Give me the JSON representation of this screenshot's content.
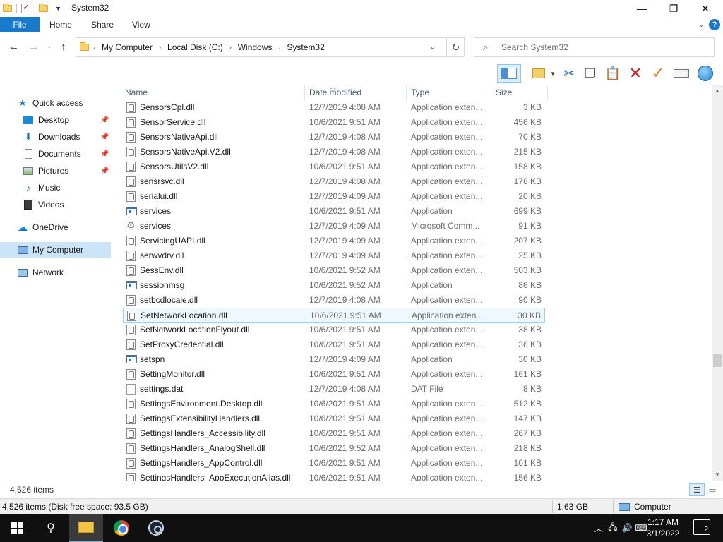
{
  "window": {
    "title": "System32",
    "minimize_glyph": "—",
    "maximize_glyph": "❐",
    "close_glyph": "✕"
  },
  "ribbon": {
    "tabs": [
      {
        "label": "File"
      },
      {
        "label": "Home"
      },
      {
        "label": "Share"
      },
      {
        "label": "View"
      }
    ],
    "help_label": "?"
  },
  "address": {
    "crumbs": [
      "My Computer",
      "Local Disk (C:)",
      "Windows",
      "System32"
    ]
  },
  "search": {
    "placeholder": "Search System32"
  },
  "toolbar": {
    "icons": [
      "layout-pane-icon",
      "new-folder-icon",
      "cut-icon",
      "copy-icon",
      "paste-icon",
      "delete-icon",
      "check-icon",
      "rename-icon",
      "globe-icon"
    ]
  },
  "sidebar": {
    "items": [
      {
        "label": "Quick access",
        "icon": "star-icon",
        "pinned": false
      },
      {
        "label": "Desktop",
        "icon": "desktop-icon",
        "pinned": true
      },
      {
        "label": "Downloads",
        "icon": "download-icon",
        "pinned": true
      },
      {
        "label": "Documents",
        "icon": "documents-icon",
        "pinned": true
      },
      {
        "label": "Pictures",
        "icon": "pictures-icon",
        "pinned": true
      },
      {
        "label": "Music",
        "icon": "music-icon",
        "pinned": false
      },
      {
        "label": "Videos",
        "icon": "videos-icon",
        "pinned": false
      },
      {
        "label": "OneDrive",
        "icon": "cloud-icon",
        "pinned": false
      },
      {
        "label": "My Computer",
        "icon": "computer-icon",
        "pinned": false,
        "selected": true
      },
      {
        "label": "Network",
        "icon": "network-icon",
        "pinned": false
      }
    ]
  },
  "columns": {
    "name": "Name",
    "date": "Date modified",
    "type": "Type",
    "size": "Size"
  },
  "files": [
    {
      "name": "SensorsCpl.dll",
      "date": "12/7/2019 4:08 AM",
      "type": "Application exten...",
      "size": "3 KB",
      "icon": "dll"
    },
    {
      "name": "SensorService.dll",
      "date": "10/6/2021 9:51 AM",
      "type": "Application exten...",
      "size": "456 KB",
      "icon": "dll"
    },
    {
      "name": "SensorsNativeApi.dll",
      "date": "12/7/2019 4:08 AM",
      "type": "Application exten...",
      "size": "70 KB",
      "icon": "dll"
    },
    {
      "name": "SensorsNativeApi.V2.dll",
      "date": "12/7/2019 4:08 AM",
      "type": "Application exten...",
      "size": "215 KB",
      "icon": "dll"
    },
    {
      "name": "SensorsUtilsV2.dll",
      "date": "10/6/2021 9:51 AM",
      "type": "Application exten...",
      "size": "158 KB",
      "icon": "dll"
    },
    {
      "name": "sensrsvc.dll",
      "date": "12/7/2019 4:08 AM",
      "type": "Application exten...",
      "size": "178 KB",
      "icon": "dll"
    },
    {
      "name": "serialui.dll",
      "date": "12/7/2019 4:09 AM",
      "type": "Application exten...",
      "size": "20 KB",
      "icon": "dll"
    },
    {
      "name": "services",
      "date": "10/6/2021 9:51 AM",
      "type": "Application",
      "size": "699 KB",
      "icon": "app"
    },
    {
      "name": "services",
      "date": "12/7/2019 4:09 AM",
      "type": "Microsoft Comm...",
      "size": "91 KB",
      "icon": "gear"
    },
    {
      "name": "ServicingUAPI.dll",
      "date": "12/7/2019 4:09 AM",
      "type": "Application exten...",
      "size": "207 KB",
      "icon": "dll"
    },
    {
      "name": "serwvdrv.dll",
      "date": "12/7/2019 4:09 AM",
      "type": "Application exten...",
      "size": "25 KB",
      "icon": "dll"
    },
    {
      "name": "SessEnv.dll",
      "date": "10/6/2021 9:52 AM",
      "type": "Application exten...",
      "size": "503 KB",
      "icon": "dll"
    },
    {
      "name": "sessionmsg",
      "date": "10/6/2021 9:52 AM",
      "type": "Application",
      "size": "86 KB",
      "icon": "app"
    },
    {
      "name": "setbcdlocale.dll",
      "date": "12/7/2019 4:08 AM",
      "type": "Application exten...",
      "size": "90 KB",
      "icon": "dll"
    },
    {
      "name": "SetNetworkLocation.dll",
      "date": "10/6/2021 9:51 AM",
      "type": "Application exten...",
      "size": "30 KB",
      "icon": "dll",
      "hover": true
    },
    {
      "name": "SetNetworkLocationFlyout.dll",
      "date": "10/6/2021 9:51 AM",
      "type": "Application exten...",
      "size": "38 KB",
      "icon": "dll"
    },
    {
      "name": "SetProxyCredential.dll",
      "date": "10/6/2021 9:51 AM",
      "type": "Application exten...",
      "size": "36 KB",
      "icon": "dll"
    },
    {
      "name": "setspn",
      "date": "12/7/2019 4:09 AM",
      "type": "Application",
      "size": "30 KB",
      "icon": "app"
    },
    {
      "name": "SettingMonitor.dll",
      "date": "10/6/2021 9:51 AM",
      "type": "Application exten...",
      "size": "161 KB",
      "icon": "dll"
    },
    {
      "name": "settings.dat",
      "date": "12/7/2019 4:08 AM",
      "type": "DAT File",
      "size": "8 KB",
      "icon": "dat"
    },
    {
      "name": "SettingsEnvironment.Desktop.dll",
      "date": "10/6/2021 9:51 AM",
      "type": "Application exten...",
      "size": "512 KB",
      "icon": "dll"
    },
    {
      "name": "SettingsExtensibilityHandlers.dll",
      "date": "10/6/2021 9:51 AM",
      "type": "Application exten...",
      "size": "147 KB",
      "icon": "dll"
    },
    {
      "name": "SettingsHandlers_Accessibility.dll",
      "date": "10/6/2021 9:51 AM",
      "type": "Application exten...",
      "size": "267 KB",
      "icon": "dll"
    },
    {
      "name": "SettingsHandlers_AnalogShell.dll",
      "date": "10/6/2021 9:52 AM",
      "type": "Application exten...",
      "size": "218 KB",
      "icon": "dll"
    },
    {
      "name": "SettingsHandlers_AppControl.dll",
      "date": "10/6/2021 9:51 AM",
      "type": "Application exten...",
      "size": "101 KB",
      "icon": "dll"
    },
    {
      "name": "SettingsHandlers_AppExecutionAlias.dll",
      "date": "10/6/2021 9:51 AM",
      "type": "Application exten...",
      "size": "156 KB",
      "icon": "dll"
    }
  ],
  "status": {
    "item_count": "4,526 items",
    "disk_info": "4,526 items (Disk free space: 93.5 GB)",
    "size_total": "1.63 GB",
    "location": "Computer"
  },
  "taskbar": {
    "time": "1:17 AM",
    "date": "3/1/2022",
    "notification_count": "2",
    "apps": [
      "start-icon",
      "search-icon",
      "file-explorer-icon",
      "chrome-icon",
      "steam-icon"
    ]
  }
}
